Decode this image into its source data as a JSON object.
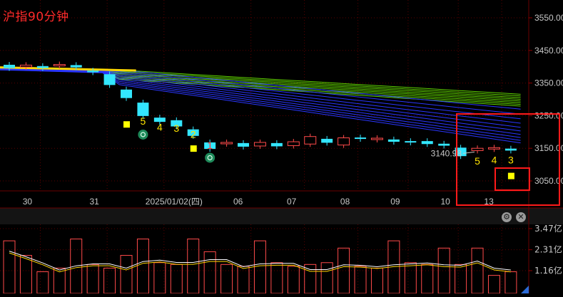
{
  "chart_title": "沪指90分钟",
  "colors": {
    "up": "#ff4a4a",
    "down": "#33e6ff",
    "ma_green": "#5fd400",
    "ma_blue": "#2a36ff",
    "ma_yellow": "#ffd800",
    "signal_square": "#ffff00",
    "signal_digit": "#ffe400",
    "signal_digit_red": "#ff3030",
    "highlight_box": "#ff1a1a",
    "grid": "#5a0000",
    "axis_text": "#c8c8c8"
  },
  "toolbar": {
    "settings_icon": "gear-icon",
    "close_icon": "close-icon",
    "close_glyph": "✕",
    "settings_glyph": "⚙"
  },
  "chart_data": [
    {
      "type": "candlestick",
      "title": "沪指90分钟",
      "y_ticks": [
        "3550.00",
        "3450.00",
        "3350.00",
        "3250.00",
        "3150.00",
        "3050.00"
      ],
      "ylim": [
        3005,
        3580
      ],
      "x_ticks": [
        "30",
        "31",
        "2025/01/02(四)",
        "06",
        "07",
        "08",
        "09",
        "10",
        "13"
      ],
      "candles": [
        {
          "o": 3406,
          "c": 3396
        },
        {
          "o": 3399,
          "c": 3405
        },
        {
          "o": 3402,
          "c": 3396
        },
        {
          "o": 3403,
          "c": 3407
        },
        {
          "o": 3405,
          "c": 3398
        },
        {
          "o": 3388,
          "c": 3383
        },
        {
          "o": 3377,
          "c": 3344
        },
        {
          "o": 3330,
          "c": 3304
        },
        {
          "o": 3290,
          "c": 3249
        },
        {
          "o": 3244,
          "c": 3231
        },
        {
          "o": 3236,
          "c": 3217
        },
        {
          "o": 3208,
          "c": 3188
        },
        {
          "o": 3168,
          "c": 3148
        },
        {
          "o": 3164,
          "c": 3168
        },
        {
          "o": 3166,
          "c": 3155
        },
        {
          "o": 3157,
          "c": 3168
        },
        {
          "o": 3166,
          "c": 3156
        },
        {
          "o": 3158,
          "c": 3170
        },
        {
          "o": 3163,
          "c": 3186
        },
        {
          "o": 3179,
          "c": 3167
        },
        {
          "o": 3160,
          "c": 3182
        },
        {
          "o": 3183,
          "c": 3179
        },
        {
          "o": 3178,
          "c": 3181
        },
        {
          "o": 3177,
          "c": 3170
        },
        {
          "o": 3172,
          "c": 3171
        },
        {
          "o": 3172,
          "c": 3163
        },
        {
          "o": 3164,
          "c": 3158
        },
        {
          "o": 3152,
          "c": 3126
        },
        {
          "o": 3143,
          "c": 3150
        },
        {
          "o": 3149,
          "c": 3152
        },
        {
          "o": 3149,
          "c": 3143
        }
      ],
      "annotations": {
        "low_label": "3140.98",
        "low_value": 3140.98,
        "signal_digits": [
          {
            "text": "5",
            "candle": 8,
            "value": 3222
          },
          {
            "text": "4",
            "candle": 9,
            "value": 3204
          },
          {
            "text": "3",
            "candle": 10,
            "value": 3201
          },
          {
            "text": "2",
            "candle": 11,
            "value": 3182
          },
          {
            "text": "1",
            "candle": 12,
            "value": 3148,
            "red": true
          },
          {
            "text": "5",
            "candle": 28,
            "value": 3100
          },
          {
            "text": "4",
            "candle": 29,
            "value": 3104
          },
          {
            "text": "3",
            "candle": 30,
            "value": 3104
          }
        ],
        "signal_squares": [
          {
            "candle": 7,
            "value": 3222
          },
          {
            "candle": 11,
            "value": 3148
          },
          {
            "candle": 30,
            "value": 3064
          }
        ],
        "signal_icons": [
          {
            "candle": 8,
            "value": 3192
          },
          {
            "candle": 12,
            "value": 3121
          }
        ]
      }
    },
    {
      "type": "bar",
      "y_ticks": [
        "3.47亿",
        "2.31亿",
        "1.16亿"
      ],
      "ylim": [
        0,
        3.47
      ],
      "values": [
        2.8,
        2.0,
        1.1,
        1.3,
        2.9,
        1.5,
        1.3,
        2.0,
        2.9,
        1.6,
        1.5,
        2.9,
        2.2,
        1.5,
        1.4,
        2.8,
        1.6,
        1.4,
        1.5,
        1.6,
        2.4,
        1.4,
        1.3,
        2.8,
        1.6,
        1.5,
        2.4,
        1.5,
        2.4,
        0.9,
        1.1
      ]
    }
  ]
}
